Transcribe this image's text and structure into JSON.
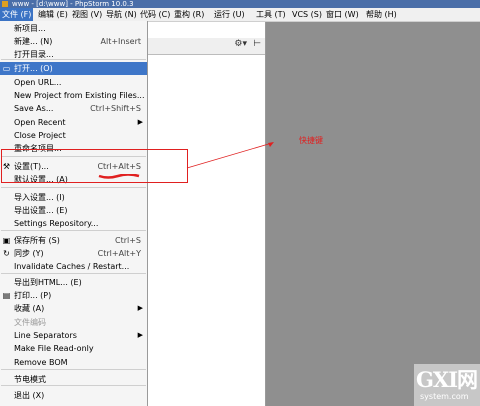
{
  "window": {
    "title": "www - [d:\\www] - PhpStorm 10.0.3"
  },
  "menubar": [
    {
      "label": "文件 (F)",
      "active": true
    },
    {
      "label": "编辑 (E)"
    },
    {
      "label": "视图 (V)"
    },
    {
      "label": "导航 (N)"
    },
    {
      "label": "代码 (C)"
    },
    {
      "label": "重构 (R)"
    },
    {
      "label": "运行 (U)"
    },
    {
      "label": "工具 (T)"
    },
    {
      "label": "VCS (S)"
    },
    {
      "label": "窗口 (W)"
    },
    {
      "label": "帮助 (H)"
    }
  ],
  "toolbar": {
    "gear_icon": "⚙▾",
    "pin_icon": "⊢"
  },
  "menu": [
    {
      "label": "新项目..."
    },
    {
      "label": "新建... (N)",
      "shortcut": "Alt+Insert"
    },
    {
      "label": "打开目录..."
    },
    {
      "label": "打开... (O)",
      "active": true,
      "icon": "folder-icon"
    },
    {
      "label": "Open URL..."
    },
    {
      "label": "New Project from Existing Files..."
    },
    {
      "label": "Save As...",
      "shortcut": "Ctrl+Shift+S"
    },
    {
      "label": "Open Recent",
      "submenu": true
    },
    {
      "label": "Close Project"
    },
    {
      "label": "重命名项目..."
    },
    {
      "label": "设置(T)...",
      "shortcut": "Ctrl+Alt+S",
      "icon": "settings-icon"
    },
    {
      "label": "默认设置... (A)"
    },
    {
      "label": "导入设置... (I)"
    },
    {
      "label": "导出设置... (E)"
    },
    {
      "label": "Settings Repository..."
    },
    {
      "label": "保存所有 (S)",
      "shortcut": "Ctrl+S",
      "icon": "save-icon"
    },
    {
      "label": "同步 (Y)",
      "shortcut": "Ctrl+Alt+Y",
      "icon": "sync-icon"
    },
    {
      "label": "Invalidate Caches / Restart..."
    },
    {
      "label": "导出到HTML... (E)"
    },
    {
      "label": "打印... (P)",
      "icon": "print-icon"
    },
    {
      "label": "收藏 (A)",
      "submenu": true
    },
    {
      "label": "文件编码",
      "disabled": true
    },
    {
      "label": "Line Separators",
      "submenu": true
    },
    {
      "label": "Make File Read-only"
    },
    {
      "label": "Remove BOM"
    },
    {
      "label": "节电模式"
    },
    {
      "label": "退出 (X)"
    }
  ],
  "annotation": {
    "text": "快捷键",
    "color": "#e02020"
  },
  "watermark": {
    "big": "GXI网",
    "small": "system.com"
  },
  "colors": {
    "accent": "#3e76c8",
    "annotation": "#e02020",
    "panel": "#8f8f8f"
  }
}
